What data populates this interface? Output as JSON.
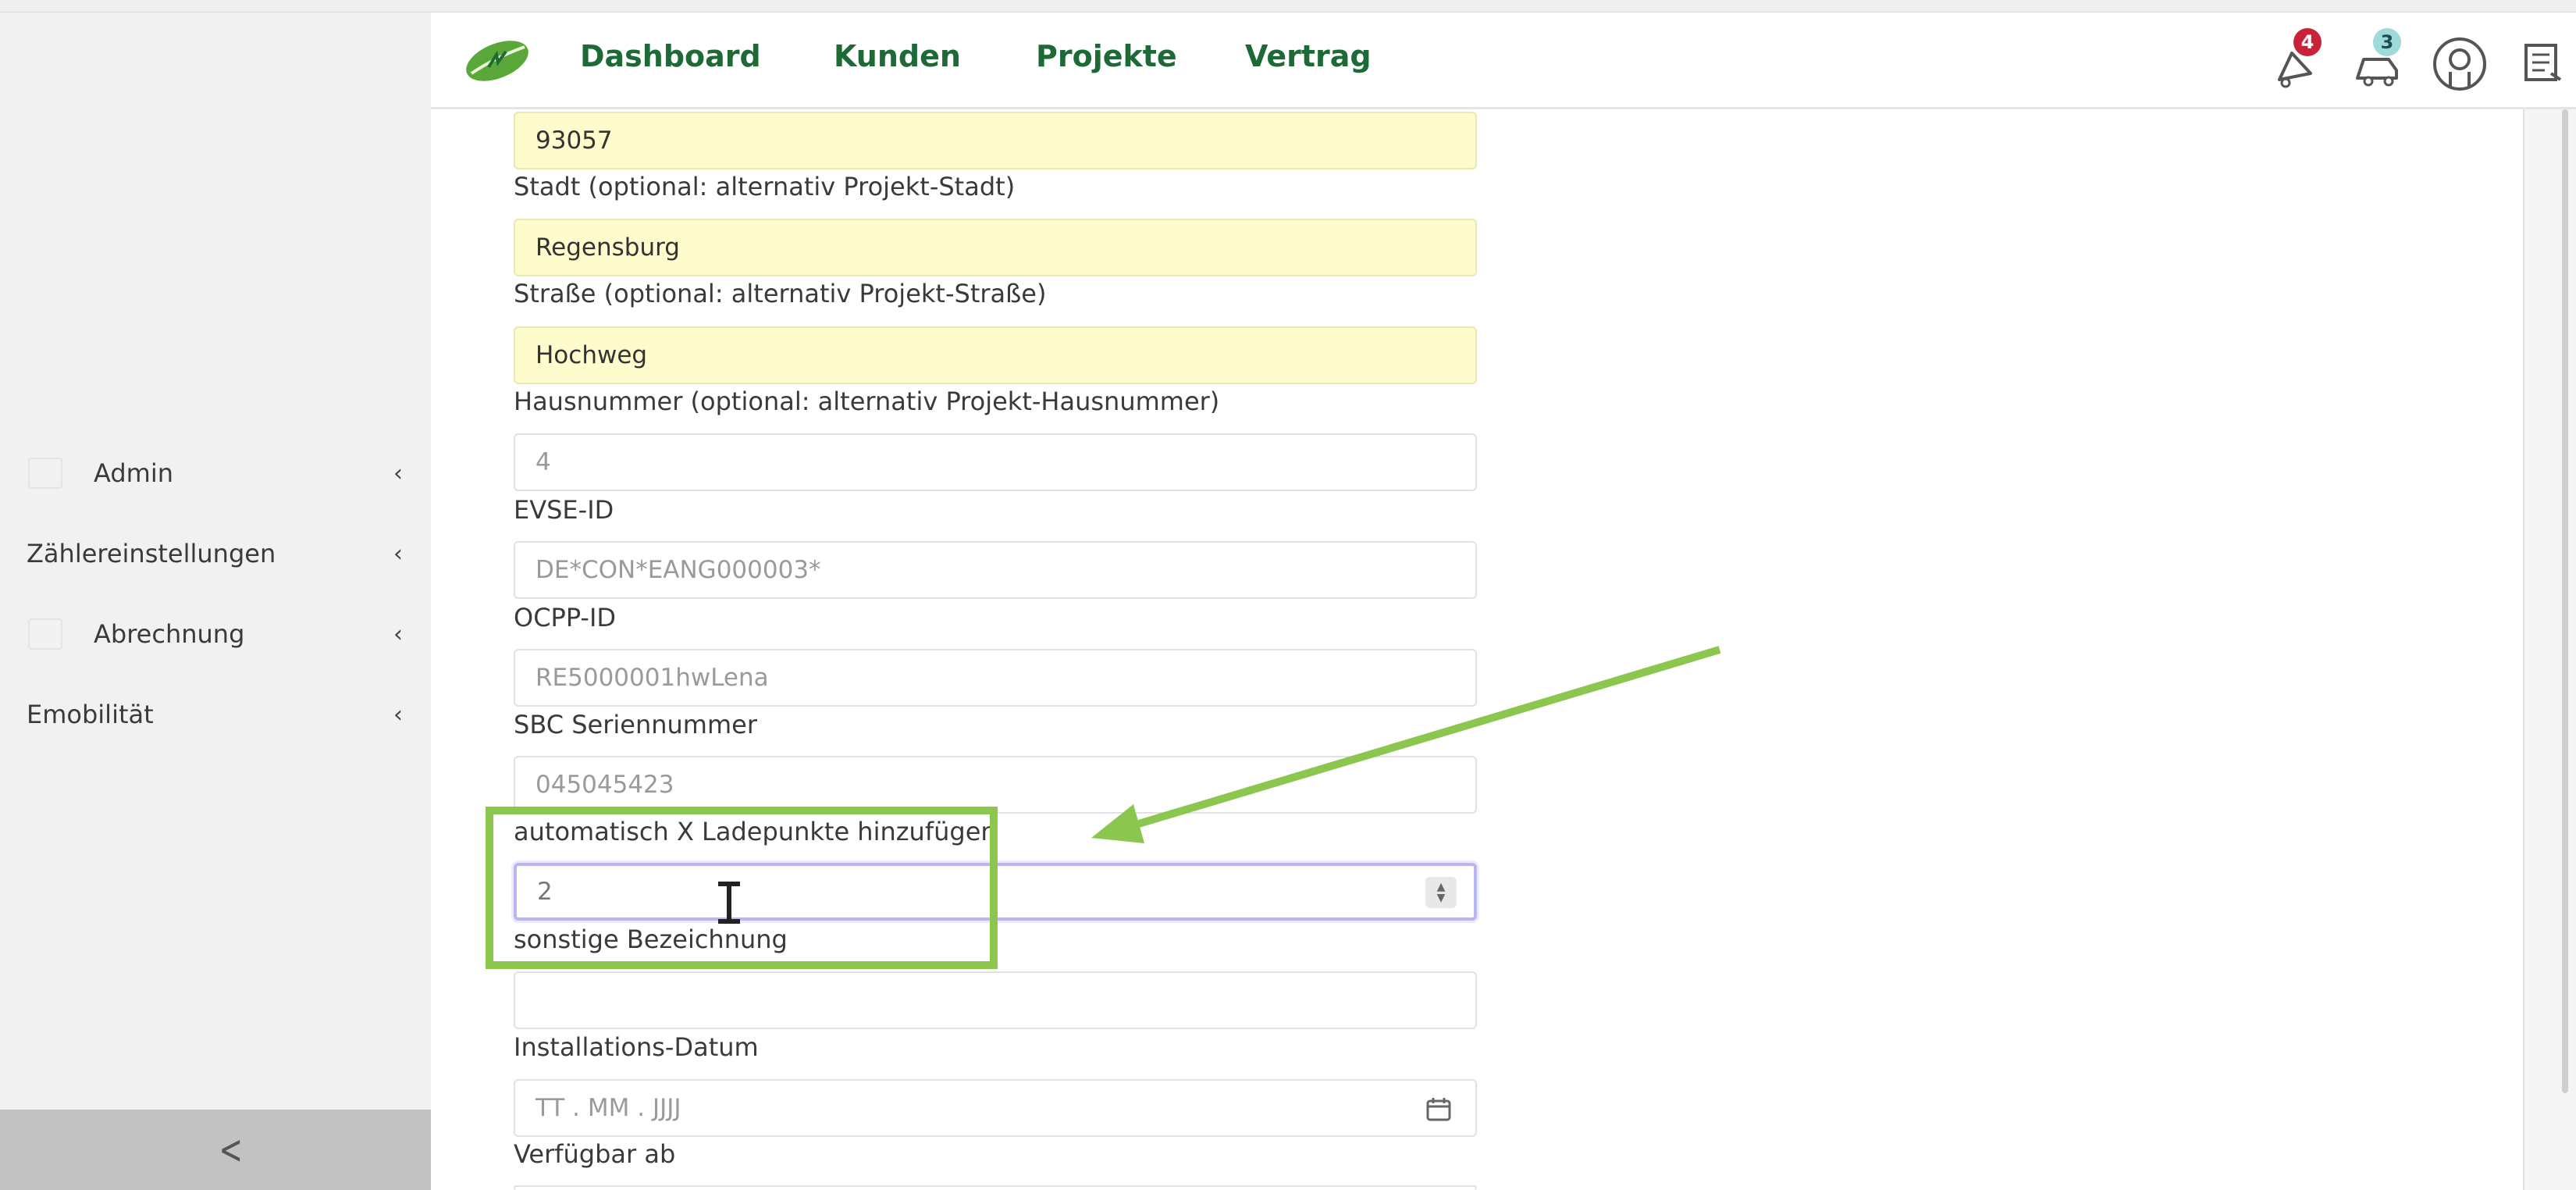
{
  "nav": {
    "items": [
      "Dashboard",
      "Kunden",
      "Projekte",
      "Vertrag"
    ],
    "notifications_count": "4",
    "messages_count": "3"
  },
  "sidebar": {
    "items": [
      {
        "label": "Admin"
      },
      {
        "label": "Zählereinstellungen"
      },
      {
        "label": "Abrechnung"
      },
      {
        "label": "Emobilität"
      }
    ]
  },
  "form": {
    "postal_code_value": "93057",
    "city_label": "Stadt (optional: alternativ Projekt-Stadt)",
    "city_value": "Regensburg",
    "street_label": "Straße (optional: alternativ Projekt-Straße)",
    "street_value": "Hochweg",
    "house_number_label": "Hausnummer (optional: alternativ Projekt-Hausnummer)",
    "house_number_value": "4",
    "evse_label": "EVSE-ID",
    "evse_value": "DE*CON*EANG000003*",
    "ocpp_label": "OCPP-ID",
    "ocpp_value": "RE5000001hwLena",
    "sbc_label": "SBC Seriennummer",
    "sbc_value": "045045423",
    "auto_label": "automatisch X Ladepunkte hinzufügen",
    "auto_value": "2",
    "other_label": "sonstige Bezeichnung",
    "other_value": "",
    "install_label": "Installations-Datum",
    "install_placeholder": "TT . MM . JJJJ",
    "available_label": "Verfügbar ab"
  },
  "colors": {
    "nav_text": "#1e6a37",
    "field_highlight": "#fefbcc",
    "annotation": "#8bc64f",
    "badge_red": "#c8223a",
    "badge_teal": "#9fdada"
  }
}
